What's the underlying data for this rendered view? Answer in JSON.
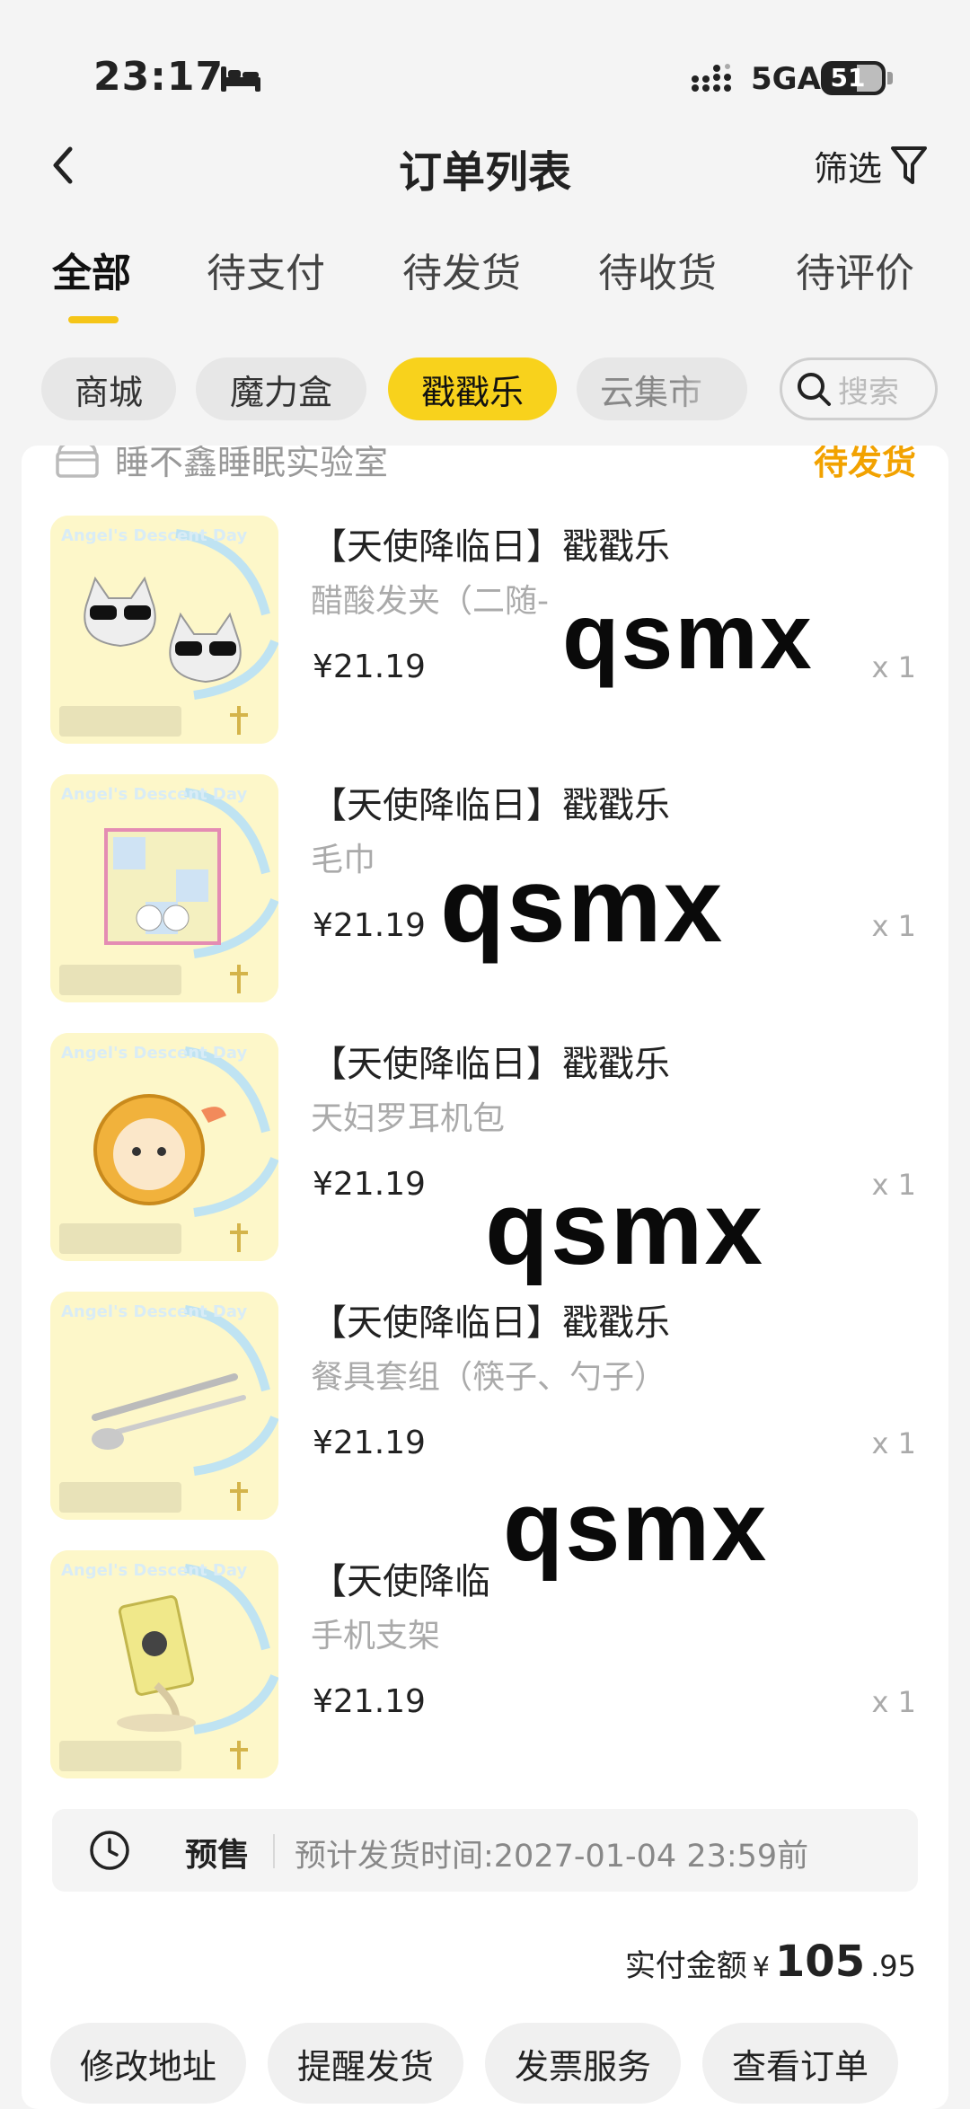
{
  "status_bar": {
    "time": "23:17",
    "network": "5GA",
    "battery": "51"
  },
  "nav": {
    "title": "订单列表",
    "filter_label": "筛选"
  },
  "tabs": [
    "全部",
    "待支付",
    "待发货",
    "待收货",
    "待评价"
  ],
  "chips": [
    "商城",
    "魔力盒",
    "戳戳乐",
    "云集市"
  ],
  "search": {
    "placeholder": "搜索"
  },
  "order": {
    "store_name": "睡不鑫睡眠实验室",
    "status": "待发货",
    "items": [
      {
        "title": "【天使降临日】戳戳乐",
        "subtitle": "醋酸发夹（二随-",
        "price": "¥21.19",
        "qty": "x 1"
      },
      {
        "title": "【天使降临日】戳戳乐",
        "subtitle": "毛巾",
        "price": "¥21.19",
        "qty": "x 1"
      },
      {
        "title": "【天使降临日】戳戳乐",
        "subtitle": "天妇罗耳机包",
        "price": "¥21.19",
        "qty": "x 1"
      },
      {
        "title": "【天使降临日】戳戳乐",
        "subtitle": "餐具套组（筷子、勺子）",
        "price": "¥21.19",
        "qty": "x 1"
      },
      {
        "title": "【天使降临",
        "subtitle": "手机支架",
        "price": "¥21.19",
        "qty": "x 1"
      }
    ],
    "presale": {
      "label": "预售",
      "text": "预计发货时间:2027-01-04 23:59前"
    },
    "total": {
      "label": "实付金额",
      "currency": "¥",
      "integer": "105",
      "decimal": ".95"
    },
    "actions": [
      "修改地址",
      "提醒发货",
      "发票服务",
      "查看订单"
    ]
  },
  "watermark": "qsmx",
  "thumb_caption": "Angel's Descent Day",
  "colors": {
    "accent": "#f8d21c",
    "status": "#f2a200",
    "thumb_bg": "#fdf6c8"
  }
}
